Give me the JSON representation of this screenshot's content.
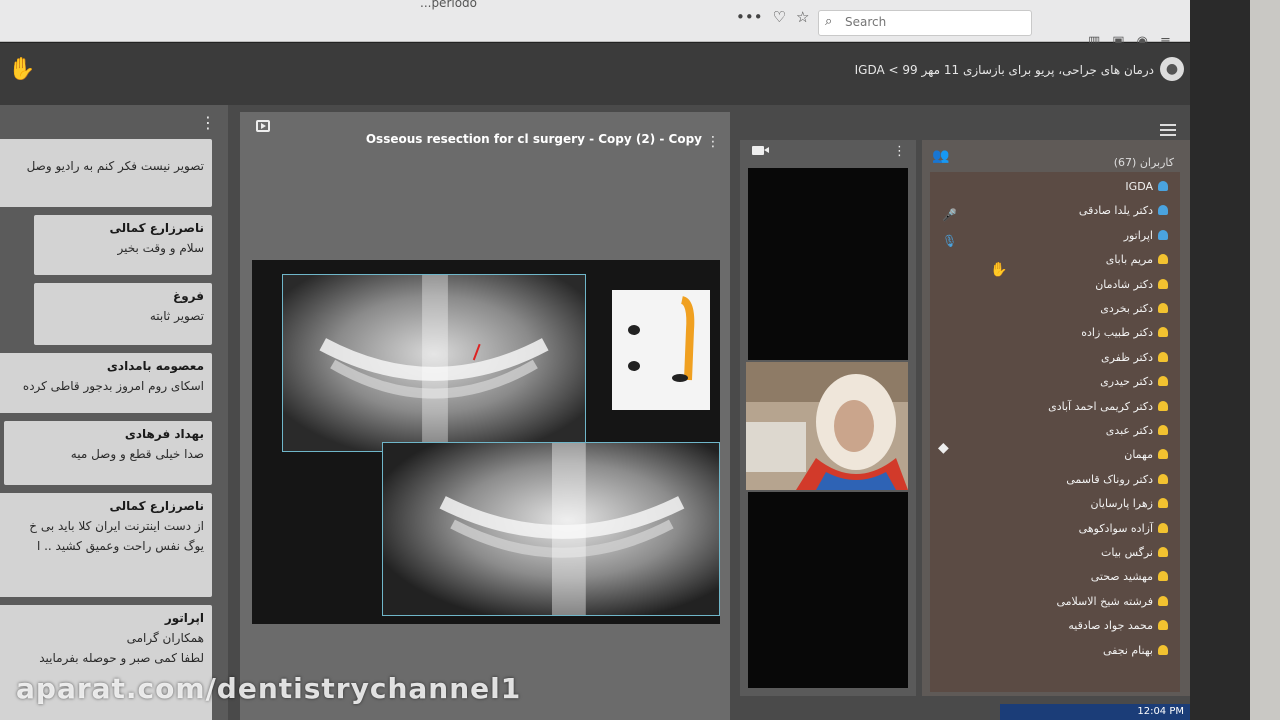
{
  "browser": {
    "url_tail": "...periodo",
    "search_placeholder": "Search"
  },
  "header": {
    "breadcrumb": "IGDA < درمان های جراحی، پریو برای بازسازی 11 مهر 99"
  },
  "chat": {
    "messages": [
      {
        "name": "",
        "text": "تصویر نیست فکر کنم به رادیو وصل"
      },
      {
        "name": "ناصرزارع کمالی",
        "text": "سلام و وقت بخیر"
      },
      {
        "name": "فروغ",
        "text": "تصویر ثابته"
      },
      {
        "name": "معصومه بامدادی",
        "text": "اسکای روم امروز بدجور قاطی کرده"
      },
      {
        "name": "بهداد فرهادی",
        "text": "صدا خیلی قطع و وصل میه"
      },
      {
        "name": "ناصرزارع کمالی",
        "text": "از دست اینترنت ایران کلا باید بی خ"
      },
      {
        "name": "",
        "text": "یوگ نفس راحت وعمیق کشید .. ا"
      },
      {
        "name": "اپراتور",
        "text": "همکاران گرامی"
      },
      {
        "name": "",
        "text": "لطفا کمی صبر و حوصله بفرمایید"
      }
    ]
  },
  "presentation": {
    "title": "Osseous resection for cl surgery - Copy (2) - Copy"
  },
  "users": {
    "title": "کاربران (67)",
    "list": [
      {
        "name": "IGDA",
        "color": "#4aa3df"
      },
      {
        "name": "دکتر یلدا صادقی",
        "color": "#4aa3df"
      },
      {
        "name": "اپراتور",
        "color": "#4aa3df"
      },
      {
        "name": "مریم بابای",
        "color": "#f2c230"
      },
      {
        "name": "دکتر شادمان",
        "color": "#f2c230"
      },
      {
        "name": "دکتر بخردی",
        "color": "#f2c230"
      },
      {
        "name": "دکتر طبیب زاده",
        "color": "#f2c230"
      },
      {
        "name": "دکتر ظفری",
        "color": "#f2c230"
      },
      {
        "name": "دکتر حیدری",
        "color": "#f2c230"
      },
      {
        "name": "دکتر کریمی احمد آبادی",
        "color": "#f2c230"
      },
      {
        "name": "دکتر عبدی",
        "color": "#f2c230"
      },
      {
        "name": "مهمان",
        "color": "#f2c230"
      },
      {
        "name": "دکتر روناک قاسمی",
        "color": "#f2c230"
      },
      {
        "name": "زهرا پارسایان",
        "color": "#f2c230"
      },
      {
        "name": "آزاده سوادکوهی",
        "color": "#f2c230"
      },
      {
        "name": "نرگس بیات",
        "color": "#f2c230"
      },
      {
        "name": "مهشید صحتی",
        "color": "#f2c230"
      },
      {
        "name": "فرشته شیخ الاسلامی",
        "color": "#f2c230"
      },
      {
        "name": "محمد جواد صادقیه",
        "color": "#f2c230"
      },
      {
        "name": "بهنام نجفی",
        "color": "#f2c230"
      }
    ]
  },
  "taskbar": {
    "clock": "12:04 PM"
  },
  "watermark": "aparat.com/dentistrychannel1"
}
